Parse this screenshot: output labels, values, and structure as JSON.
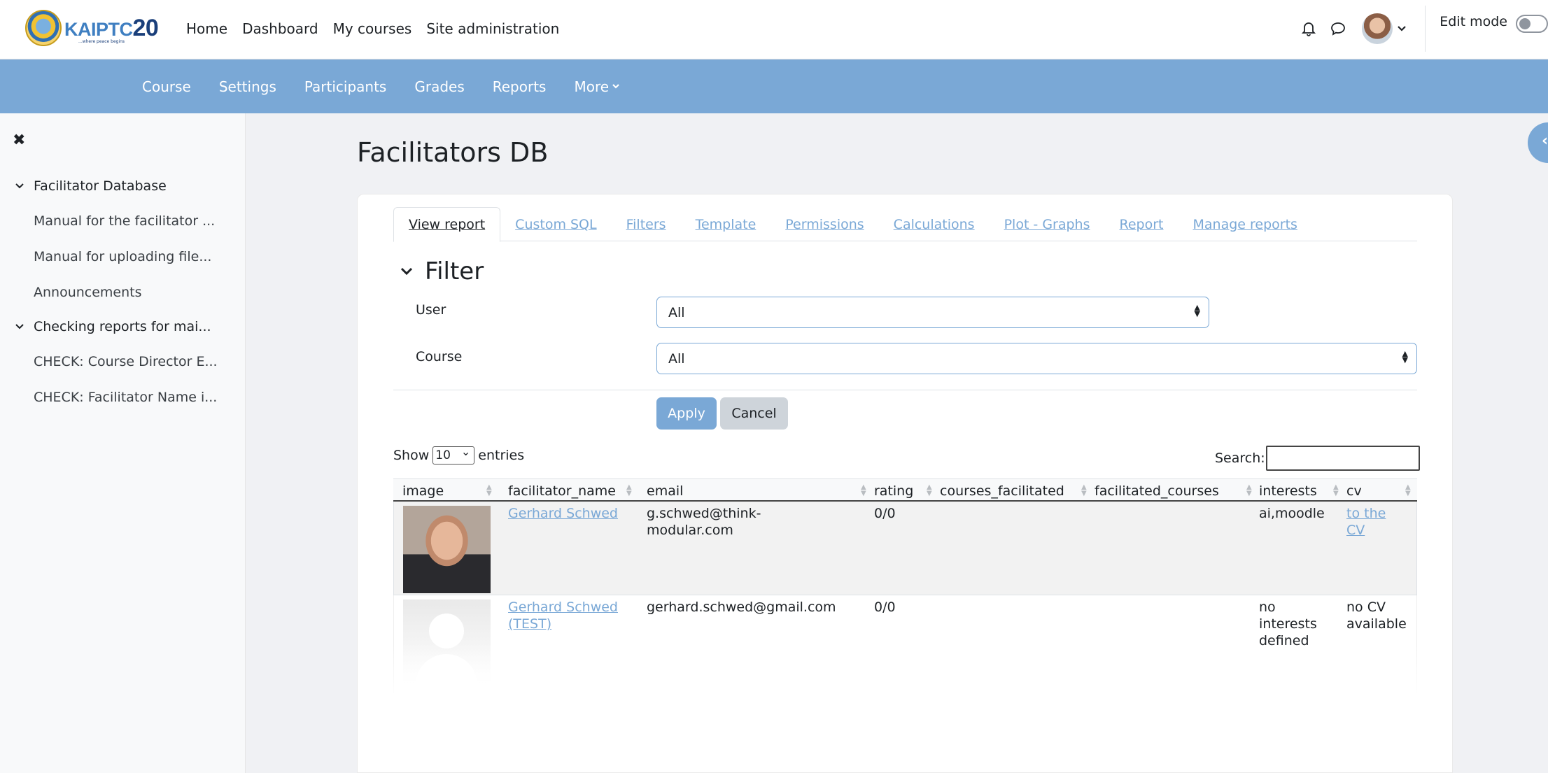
{
  "brand": {
    "name": "KAIPTC",
    "number": "20",
    "tagline": "...where peace begins"
  },
  "topnav": {
    "items": [
      "Home",
      "Dashboard",
      "My courses",
      "Site administration"
    ]
  },
  "user": {
    "edit_mode_label": "Edit mode"
  },
  "icons": {
    "bell": "bell-icon",
    "chat": "chat-icon",
    "avatar_menu": "chevron-down-icon"
  },
  "secnav": {
    "items": [
      "Course",
      "Settings",
      "Participants",
      "Grades",
      "Reports"
    ],
    "more": "More"
  },
  "drawer": {
    "close": "✖",
    "sections": [
      {
        "title": "Facilitator Database",
        "items": [
          "Manual for the facilitator ...",
          "Manual for uploading file...",
          "Announcements"
        ]
      },
      {
        "title": "Checking reports for mai...",
        "items": [
          "CHECK: Course Director E...",
          "CHECK: Facilitator Name i..."
        ]
      }
    ]
  },
  "page": {
    "title": "Facilitators DB"
  },
  "tabs": [
    "View report",
    "Custom SQL",
    "Filters",
    "Template",
    "Permissions",
    "Calculations",
    "Plot - Graphs",
    "Report",
    "Manage reports"
  ],
  "filter": {
    "heading": "Filter",
    "user_label": "User",
    "user_value": "All",
    "course_label": "Course",
    "course_value": "All",
    "apply": "Apply",
    "cancel": "Cancel"
  },
  "table": {
    "show_prefix": "Show",
    "page_size": "10",
    "show_suffix": "entries",
    "search_label": "Search:",
    "columns": [
      "image",
      "facilitator_name",
      "email",
      "rating",
      "courses_facilitated",
      "facilitated_courses",
      "interests",
      "cv"
    ],
    "rows": [
      {
        "name_line1": "Gerhard Schwed",
        "name_line2": "",
        "email_line1": "g.schwed@think-",
        "email_line2": "modular.com",
        "rating": "0/0",
        "interests_line1": "ai,moodle",
        "interests_line2": "",
        "interests_line3": "",
        "cv_line1": "to the",
        "cv_line2": "CV"
      },
      {
        "name_line1": "Gerhard Schwed",
        "name_line2": "(TEST)",
        "email_line1": "gerhard.schwed@gmail.com",
        "email_line2": "",
        "rating": "0/0",
        "interests_line1": "no",
        "interests_line2": "interests",
        "interests_line3": "defined",
        "cv_line1": "no CV",
        "cv_line2": "available"
      }
    ]
  }
}
